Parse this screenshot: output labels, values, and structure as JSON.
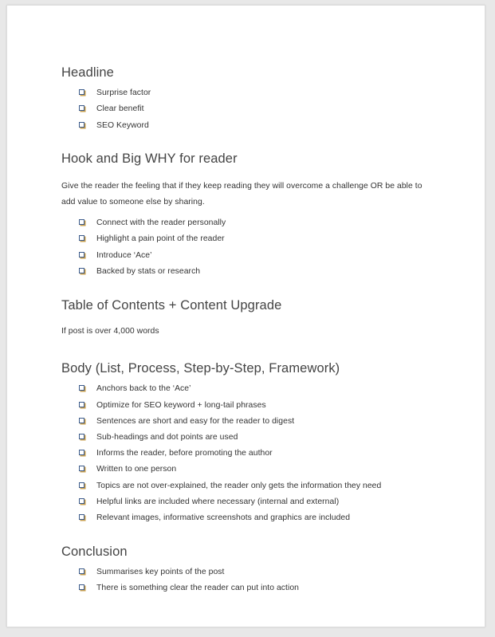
{
  "document": {
    "bullet_icon": "shadowed-white-square-icon",
    "heading_color": "#444444",
    "text_color": "#333333",
    "page_background": "#ffffff",
    "canvas_background": "#e8e8e8",
    "sections": [
      {
        "heading": "Headline",
        "paragraph": null,
        "items": [
          "Surprise factor",
          "Clear benefit",
          "SEO Keyword"
        ]
      },
      {
        "heading": "Hook and Big WHY for reader",
        "paragraph": "Give the reader the feeling that if they keep reading they will overcome a challenge OR be able to add value to someone else by sharing.",
        "items": [
          "Connect with the reader personally",
          "Highlight a pain point of the reader",
          "Introduce ‘Ace’",
          "Backed by stats or research"
        ]
      },
      {
        "heading": "Table of Contents + Content Upgrade",
        "paragraph": "If post is over 4,000 words",
        "items": []
      },
      {
        "heading": "Body (List, Process, Step-by-Step, Framework)",
        "paragraph": null,
        "items": [
          "Anchors back to the ‘Ace’",
          "Optimize for SEO keyword + long-tail phrases",
          "Sentences are short and easy for the reader to digest",
          "Sub-headings and dot points are used",
          "Informs the reader, before promoting the author",
          "Written to one person",
          "Topics are not over-explained, the reader only gets the information they need",
          "Helpful links are included where necessary (internal and external)",
          "Relevant images, informative screenshots and graphics are included"
        ]
      },
      {
        "heading": "Conclusion",
        "paragraph": null,
        "items": [
          "Summarises key points of the post",
          "There is something clear the reader can put into action"
        ]
      }
    ]
  }
}
